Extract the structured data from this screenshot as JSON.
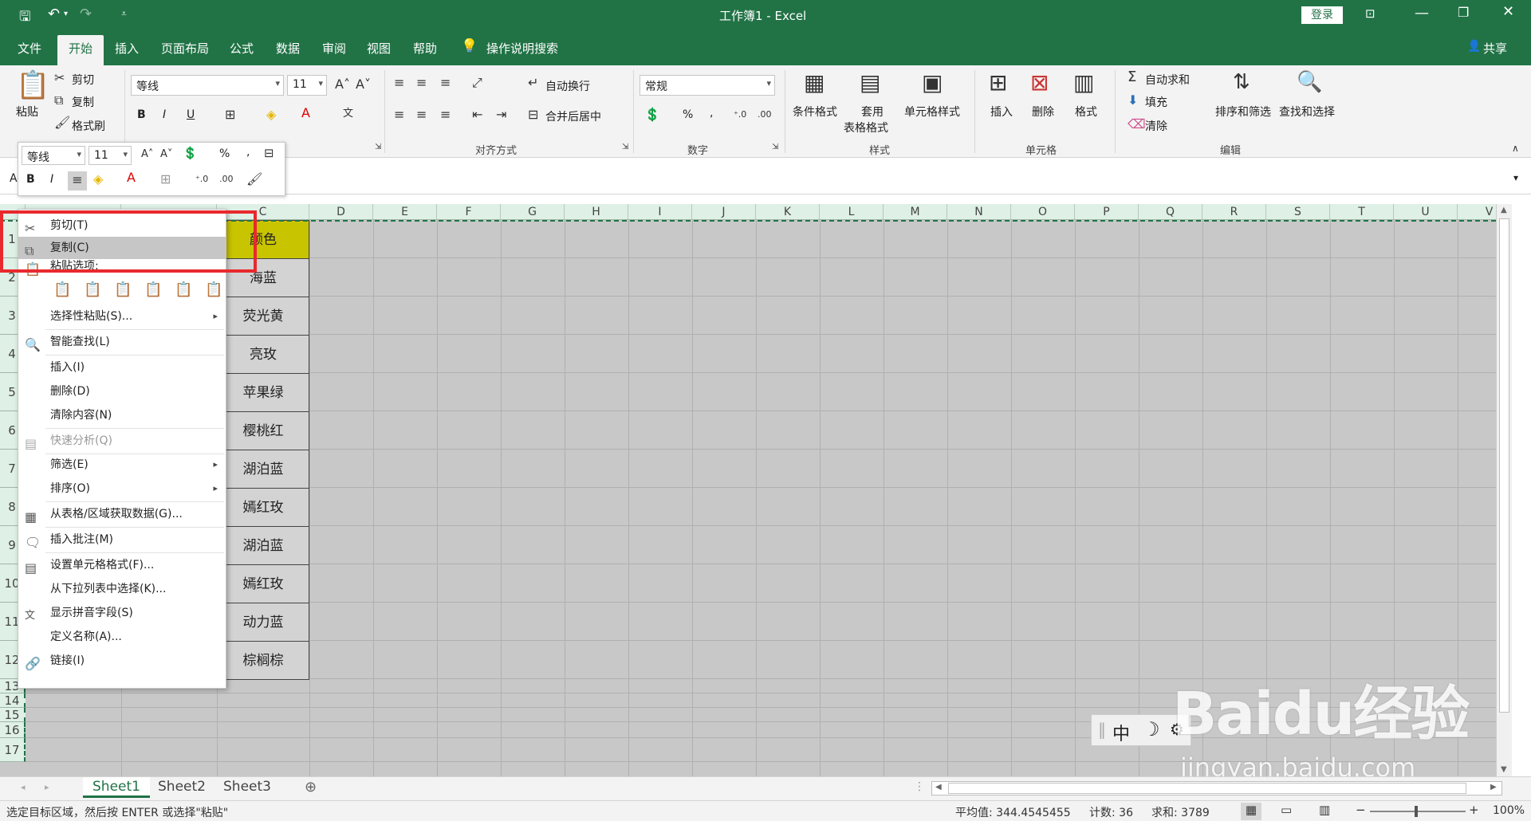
{
  "titlebar": {
    "title": "工作簿1 - Excel",
    "login_label": "登录",
    "qat_save": "save-icon",
    "qat_undo": "undo-icon",
    "qat_redo": "redo-icon"
  },
  "tabs": [
    "文件",
    "开始",
    "插入",
    "页面布局",
    "公式",
    "数据",
    "审阅",
    "视图",
    "帮助"
  ],
  "tell_me": "操作说明搜索",
  "share": "共享",
  "ribbon": {
    "clipboard": {
      "paste": "粘贴",
      "cut": "剪切",
      "copy": "复制",
      "format_painter": "格式刷"
    },
    "font": {
      "name": "等线",
      "size": "11",
      "bold": "B",
      "italic": "I",
      "underline": "U"
    },
    "alignment": {
      "wrap": "自动换行",
      "merge": "合并后居中",
      "label": "对齐方式"
    },
    "number": {
      "format": "常规",
      "label": "数字",
      "percent": "%",
      "comma": ","
    },
    "styles": {
      "conditional": "条件格式",
      "table_line1": "套用",
      "table_line2": "表格格式",
      "cell_styles": "单元格样式",
      "label": "样式"
    },
    "cells": {
      "insert": "插入",
      "delete": "删除",
      "format": "格式",
      "label": "单元格"
    },
    "editing": {
      "autosum": "自动求和",
      "fill": "填充",
      "clear": "清除",
      "sort": "排序和筛选",
      "find": "查找和选择",
      "label": "编辑"
    }
  },
  "mini_toolbar": {
    "font": "等线",
    "size": "11",
    "bold": "B",
    "italic": "I",
    "percent": "%",
    "comma": ","
  },
  "columns": [
    "D",
    "E",
    "F",
    "G",
    "H",
    "I",
    "J",
    "K",
    "L",
    "M",
    "N",
    "O",
    "P",
    "Q",
    "R",
    "S",
    "T",
    "U",
    "V"
  ],
  "col_c": "C",
  "rows": [
    "1",
    "2",
    "3",
    "4",
    "5",
    "6",
    "7",
    "8",
    "9",
    "10",
    "11",
    "12",
    "13",
    "14",
    "15",
    "16",
    "17"
  ],
  "cells": [
    "颜色",
    "海蓝",
    "荧光黄",
    "亮玫",
    "苹果绿",
    "樱桃红",
    "湖泊蓝",
    "嫣红玫",
    "湖泊蓝",
    "嫣红玫",
    "动力蓝",
    "棕榈棕"
  ],
  "context_menu": {
    "cut": "剪切(T)",
    "copy": "复制(C)",
    "paste_options": "粘贴选项:",
    "paste_special": "选择性粘贴(S)...",
    "smart_lookup": "智能查找(L)",
    "insert": "插入(I)",
    "delete": "删除(D)",
    "clear": "清除内容(N)",
    "quick_analysis": "快速分析(Q)",
    "filter": "筛选(E)",
    "sort": "排序(O)",
    "get_data": "从表格/区域获取数据(G)...",
    "insert_comment": "插入批注(M)",
    "format_cells": "设置单元格格式(F)...",
    "pick_list": "从下拉列表中选择(K)...",
    "phonetic": "显示拼音字段(S)",
    "define_name": "定义名称(A)...",
    "link": "链接(I)"
  },
  "ime": {
    "lang": "中"
  },
  "watermark": {
    "brand": "Baidu经验",
    "url": "jingyan.baidu.com"
  },
  "sheets": [
    "Sheet1",
    "Sheet2",
    "Sheet3"
  ],
  "status": {
    "message": "选定目标区域，然后按 ENTER 或选择\"粘贴\"",
    "average": "平均值: 344.4545455",
    "count": "计数: 36",
    "sum": "求和: 3789",
    "zoom": "100%"
  }
}
